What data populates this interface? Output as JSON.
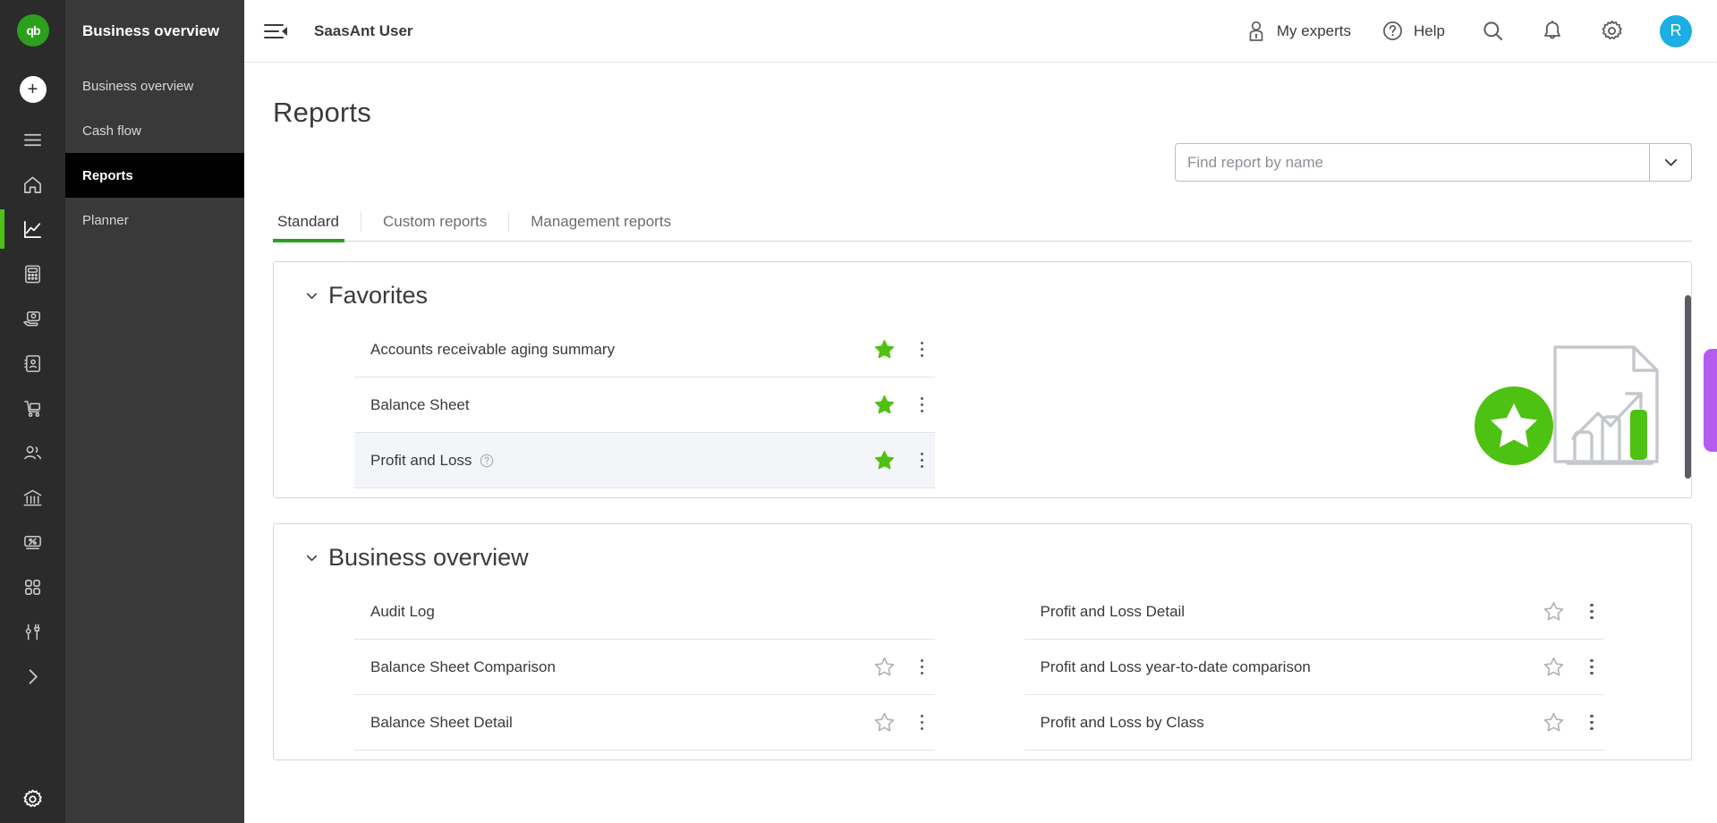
{
  "rail": {
    "logo": "qb-logo-icon",
    "add_label": "+",
    "items": [
      {
        "name": "menu-icon",
        "active": false
      },
      {
        "name": "home-icon",
        "active": false
      },
      {
        "name": "chart-icon",
        "active": true
      },
      {
        "name": "calculator-icon",
        "active": false
      },
      {
        "name": "payments-icon",
        "active": false
      },
      {
        "name": "contacts-icon",
        "active": false
      },
      {
        "name": "sales-cart-icon",
        "active": false
      },
      {
        "name": "people-icon",
        "active": false
      },
      {
        "name": "bank-icon",
        "active": false
      },
      {
        "name": "taxes-icon",
        "active": false
      },
      {
        "name": "apps-grid-icon",
        "active": false
      },
      {
        "name": "tools-icon",
        "active": false
      },
      {
        "name": "expand-chevron-icon",
        "active": false
      }
    ],
    "gear": "gear-icon"
  },
  "sidebar": {
    "title": "Business overview",
    "items": [
      {
        "label": "Business overview",
        "active": false
      },
      {
        "label": "Cash flow",
        "active": false
      },
      {
        "label": "Reports",
        "active": true
      },
      {
        "label": "Planner",
        "active": false
      }
    ]
  },
  "topbar": {
    "menu_toggle": "collapse-menu-icon",
    "company": "SaasAnt User",
    "my_experts": "My experts",
    "help": "Help",
    "search_icon": "search-icon",
    "bell_icon": "notification-bell-icon",
    "gear_icon": "settings-gear-icon",
    "avatar_initial": "R"
  },
  "page": {
    "title": "Reports"
  },
  "search": {
    "value": "",
    "placeholder": "Find report by name",
    "caret_icon": "chevron-down-icon"
  },
  "tabs": [
    {
      "label": "Standard",
      "active": true
    },
    {
      "label": "Custom reports",
      "active": false
    },
    {
      "label": "Management reports",
      "active": false
    }
  ],
  "sections": [
    {
      "title": "Favorites",
      "collapse_icon": "chevron-down-icon",
      "single_column": true,
      "illustration": "favorites-star-report-illustration",
      "left": [
        {
          "label": "Accounts receivable aging summary",
          "starred": true,
          "help": false,
          "hover": false,
          "kebab": true
        },
        {
          "label": "Balance Sheet",
          "starred": true,
          "help": false,
          "hover": false,
          "kebab": true
        },
        {
          "label": "Profit and Loss",
          "starred": true,
          "help": true,
          "hover": true,
          "kebab": true
        }
      ],
      "right": []
    },
    {
      "title": "Business overview",
      "collapse_icon": "chevron-down-icon",
      "single_column": false,
      "illustration": null,
      "left": [
        {
          "label": "Audit Log",
          "starred": false,
          "help": false,
          "hover": false,
          "kebab": false
        },
        {
          "label": "Balance Sheet Comparison",
          "starred": false,
          "help": false,
          "hover": false,
          "kebab": true
        },
        {
          "label": "Balance Sheet Detail",
          "starred": false,
          "help": false,
          "hover": false,
          "kebab": true
        }
      ],
      "right": [
        {
          "label": "Profit and Loss Detail",
          "starred": false,
          "help": false,
          "hover": false,
          "kebab": true
        },
        {
          "label": "Profit and Loss year-to-date comparison",
          "starred": false,
          "help": false,
          "hover": false,
          "kebab": true
        },
        {
          "label": "Profit and Loss by Class",
          "starred": false,
          "help": false,
          "hover": false,
          "kebab": true
        }
      ]
    }
  ],
  "widgets": {
    "scrollbar": "vertical-scrollbar",
    "feedback_tab": "feedback-tab"
  },
  "colors": {
    "brand_green": "#2ca01c",
    "star_green": "#4ec212",
    "avatar_blue": "#1caee4",
    "purple_tab": "#b45cf0",
    "rail_bg": "#2b2b2b",
    "subnav_bg": "#393939"
  }
}
